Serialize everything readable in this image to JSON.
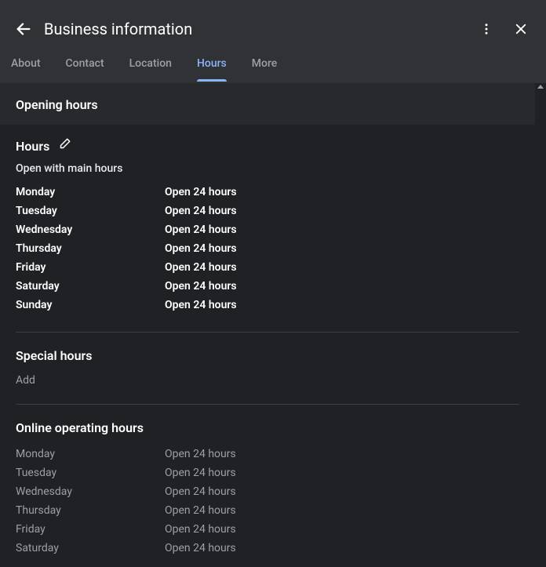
{
  "header": {
    "title": "Business information"
  },
  "tabs": {
    "about": "About",
    "contact": "Contact",
    "location": "Location",
    "hours": "Hours",
    "more": "More"
  },
  "openingHours": {
    "sectionTitle": "Opening hours"
  },
  "hoursBlock": {
    "title": "Hours",
    "subtitle": "Open with main hours",
    "rows": [
      {
        "day": "Monday",
        "hrs": "Open 24 hours"
      },
      {
        "day": "Tuesday",
        "hrs": "Open 24 hours"
      },
      {
        "day": "Wednesday",
        "hrs": "Open 24 hours"
      },
      {
        "day": "Thursday",
        "hrs": "Open 24 hours"
      },
      {
        "day": "Friday",
        "hrs": "Open 24 hours"
      },
      {
        "day": "Saturday",
        "hrs": "Open 24 hours"
      },
      {
        "day": "Sunday",
        "hrs": "Open 24 hours"
      }
    ]
  },
  "specialHours": {
    "title": "Special hours",
    "addLabel": "Add"
  },
  "onlineHours": {
    "title": "Online operating hours",
    "rows": [
      {
        "day": "Monday",
        "hrs": "Open 24 hours"
      },
      {
        "day": "Tuesday",
        "hrs": "Open 24 hours"
      },
      {
        "day": "Wednesday",
        "hrs": "Open 24 hours"
      },
      {
        "day": "Thursday",
        "hrs": "Open 24 hours"
      },
      {
        "day": "Friday",
        "hrs": "Open 24 hours"
      },
      {
        "day": "Saturday",
        "hrs": "Open 24 hours"
      }
    ]
  }
}
